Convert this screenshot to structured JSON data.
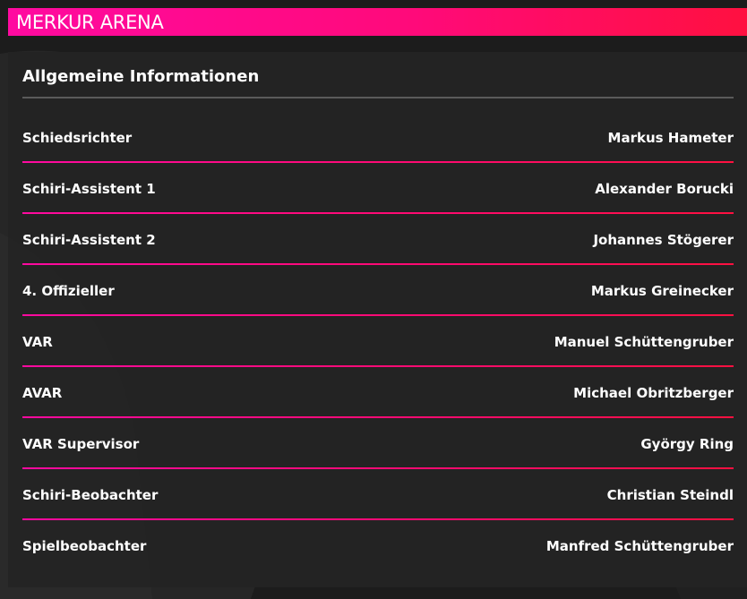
{
  "header": {
    "title": "MERKUR ARENA"
  },
  "section": {
    "title": "Allgemeine Informationen"
  },
  "officials": [
    {
      "role": "Schiedsrichter",
      "name": "Markus Hameter"
    },
    {
      "role": "Schiri-Assistent 1",
      "name": "Alexander Borucki"
    },
    {
      "role": "Schiri-Assistent 2",
      "name": "Johannes Stögerer"
    },
    {
      "role": "4. Offizieller",
      "name": "Markus Greinecker"
    },
    {
      "role": "VAR",
      "name": "Manuel Schüttengruber"
    },
    {
      "role": "AVAR",
      "name": "Michael Obritzberger"
    },
    {
      "role": "VAR Supervisor",
      "name": "György Ring"
    },
    {
      "role": "Schiri-Beobachter",
      "name": "Christian Steindl"
    },
    {
      "role": "Spielbeobachter",
      "name": "Manfred Schüttengruber"
    }
  ],
  "colors": {
    "accent_start": "#ff0aa0",
    "accent_end": "#ff1040",
    "background": "#1c1c1c",
    "panel": "#232323",
    "divider": "#5a5a5a"
  }
}
